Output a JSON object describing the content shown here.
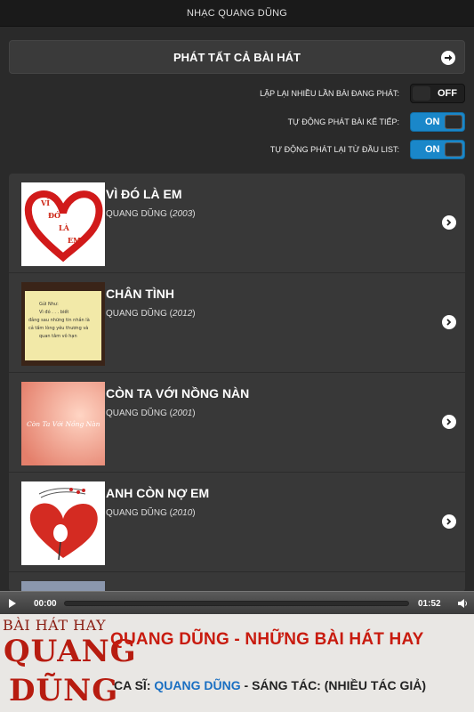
{
  "header": {
    "title": "NHẠC QUANG DŨNG"
  },
  "play_all": {
    "label": "PHÁT TẤT CẢ BÀI HÁT",
    "icon": "arrow-right-icon"
  },
  "toggles": [
    {
      "label": "LẶP LẠI NHIỀU LẦN BÀI ĐANG PHÁT:",
      "state": "OFF"
    },
    {
      "label": "TỰ ĐỘNG PHÁT BÀI KẾ TIẾP:",
      "state": "ON"
    },
    {
      "label": "TỰ ĐỘNG PHÁT LẠI TỪ ĐẦU LIST:",
      "state": "ON"
    }
  ],
  "songs": [
    {
      "title": "VÌ ĐÓ LÀ EM",
      "artist": "QUANG DŨNG",
      "year": "2003"
    },
    {
      "title": "CHÂN TÌNH",
      "artist": "QUANG DŨNG",
      "year": "2012"
    },
    {
      "title": "CÒN TA VỚI NỒNG NÀN",
      "artist": "QUANG DŨNG",
      "year": "2001"
    },
    {
      "title": "ANH CÒN NỢ EM",
      "artist": "QUANG DŨNG",
      "year": "2010"
    }
  ],
  "thumb_text": {
    "vi_do_la_em": [
      "VÌ",
      "ĐÓ",
      "LÀ",
      "EM"
    ],
    "chan_tinh": [
      "Gửi Như:",
      "Vì đó . . . biết",
      "đắng sau những tin nhắn là",
      "cả tấm lòng yêu thương và",
      "quan tâm vô hạn"
    ],
    "con_ta": "Còn Ta Với Nồng Nàn"
  },
  "player": {
    "current": "00:00",
    "duration": "01:52",
    "progress": 0
  },
  "banner": {
    "logo_top": "BÀI HÁT HAY",
    "logo_mid": "QUANG",
    "logo_bot": "DŨNG",
    "headline": "QUANG DŨNG - NHỮNG BÀI HÁT HAY",
    "singer_label": "CA SĨ:",
    "singer": "QUANG DŨNG",
    "sep": " - ",
    "composer_label": "SÁNG TÁC:",
    "composer": "(NHIỀU TÁC GIẢ)"
  },
  "colors": {
    "accent": "#1a87c9",
    "headline": "#c81b0f",
    "singer": "#1a6fc2"
  }
}
